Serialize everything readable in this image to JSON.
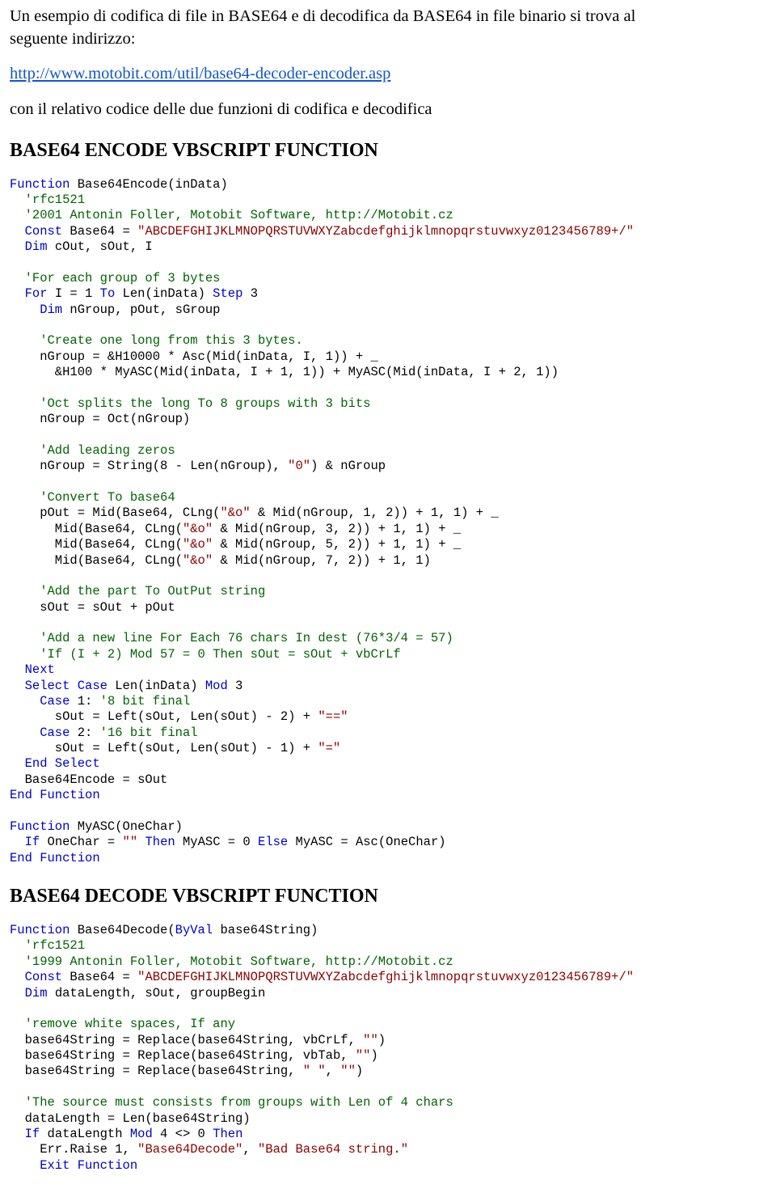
{
  "intro": {
    "line1": "Un esempio di codifica di file in BASE64 e di decodifica da BASE64 in file binario si trova al",
    "line2": "seguente indirizzo:",
    "link": "http://www.motobit.com/util/base64-decoder-encoder.asp",
    "line3": "con il relativo codice delle due funzioni di codifica e decodifica"
  },
  "heading_encode": "BASE64 ENCODE VBSCRIPT FUNCTION",
  "heading_decode": "BASE64 DECODE VBSCRIPT FUNCTION",
  "enc": {
    "l01a": "Function",
    "l01b": " Base64Encode(inData)",
    "l02": "  'rfc1521",
    "l03": "  '2001 Antonin Foller, Motobit Software, http://Motobit.cz",
    "l04a": "  Const",
    "l04b": " Base64 = ",
    "l04c": "\"ABCDEFGHIJKLMNOPQRSTUVWXYZabcdefghijklmnopqrstuvwxyz0123456789+/\"",
    "l05a": "  Dim",
    "l05b": " cOut, sOut, I",
    "l06": "  'For each group of 3 bytes",
    "l07a": "  For",
    "l07b": " I = 1 ",
    "l07c": "To",
    "l07d": " Len(inData) ",
    "l07e": "Step",
    "l07f": " 3",
    "l08a": "    Dim",
    "l08b": " nGroup, pOut, sGroup",
    "l09": "    'Create one long from this 3 bytes.",
    "l10": "    nGroup = &H10000 * Asc(Mid(inData, I, 1)) + _",
    "l11": "      &H100 * MyASC(Mid(inData, I + 1, 1)) + MyASC(Mid(inData, I + 2, 1))",
    "l12": "    'Oct splits the long To 8 groups with 3 bits",
    "l13": "    nGroup = Oct(nGroup)",
    "l14": "    'Add leading zeros",
    "l15a": "    nGroup = String(8 - Len(nGroup), ",
    "l15b": "\"0\"",
    "l15c": ") & nGroup",
    "l16": "    'Convert To base64",
    "l17a": "    pOut = Mid(Base64, CLng(",
    "l17b": "\"&o\"",
    "l17c": " & Mid(nGroup, 1, 2)) + 1, 1) + _",
    "l18a": "      Mid(Base64, CLng(",
    "l18b": "\"&o\"",
    "l18c": " & Mid(nGroup, 3, 2)) + 1, 1) + _",
    "l19a": "      Mid(Base64, CLng(",
    "l19b": "\"&o\"",
    "l19c": " & Mid(nGroup, 5, 2)) + 1, 1) + _",
    "l20a": "      Mid(Base64, CLng(",
    "l20b": "\"&o\"",
    "l20c": " & Mid(nGroup, 7, 2)) + 1, 1)",
    "l21": "    'Add the part To OutPut string",
    "l22": "    sOut = sOut + pOut",
    "l23": "    'Add a new line For Each 76 chars In dest (76*3/4 = 57)",
    "l24": "    'If (I + 2) Mod 57 = 0 Then sOut = sOut + vbCrLf",
    "l25": "  Next",
    "l26a": "  Select Case",
    "l26b": " Len(inData) ",
    "l26c": "Mod",
    "l26d": " 3",
    "l27a": "    Case",
    "l27b": " 1: ",
    "l27c": "'8 bit final",
    "l28a": "      sOut = Left(sOut, Len(sOut) - 2) + ",
    "l28b": "\"==\"",
    "l29a": "    Case",
    "l29b": " 2: ",
    "l29c": "'16 bit final",
    "l30a": "      sOut = Left(sOut, Len(sOut) - 1) + ",
    "l30b": "\"=\"",
    "l31": "  End Select",
    "l32": "  Base64Encode = sOut",
    "l33": "End Function",
    "l34a": "Function",
    "l34b": " MyASC(OneChar)",
    "l35a": "  If",
    "l35b": " OneChar = ",
    "l35c": "\"\"",
    "l35d": " ",
    "l35e": "Then",
    "l35f": " MyASC = 0 ",
    "l35g": "Else",
    "l35h": " MyASC = Asc(OneChar)",
    "l36": "End Function"
  },
  "dec": {
    "l01a": "Function",
    "l01b": " Base64Decode(",
    "l01c": "ByVal",
    "l01d": " base64String)",
    "l02": "  'rfc1521",
    "l03": "  '1999 Antonin Foller, Motobit Software, http://Motobit.cz",
    "l04a": "  Const",
    "l04b": " Base64 = ",
    "l04c": "\"ABCDEFGHIJKLMNOPQRSTUVWXYZabcdefghijklmnopqrstuvwxyz0123456789+/\"",
    "l05a": "  Dim",
    "l05b": " dataLength, sOut, groupBegin",
    "l06": "  'remove white spaces, If any",
    "l07a": "  base64String = Replace(base64String, vbCrLf, ",
    "l07b": "\"\"",
    "l07c": ")",
    "l08a": "  base64String = Replace(base64String, vbTab, ",
    "l08b": "\"\"",
    "l08c": ")",
    "l09a": "  base64String = Replace(base64String, ",
    "l09b": "\" \"",
    "l09c": ", ",
    "l09d": "\"\"",
    "l09e": ")",
    "l10": "  'The source must consists from groups with Len of 4 chars",
    "l11": "  dataLength = Len(base64String)",
    "l12a": "  If",
    "l12b": " dataLength ",
    "l12c": "Mod",
    "l12d": " 4 <> 0 ",
    "l12e": "Then",
    "l13a": "    Err.Raise 1, ",
    "l13b": "\"Base64Decode\"",
    "l13c": ", ",
    "l13d": "\"Bad Base64 string.\"",
    "l14": "    Exit Function"
  }
}
